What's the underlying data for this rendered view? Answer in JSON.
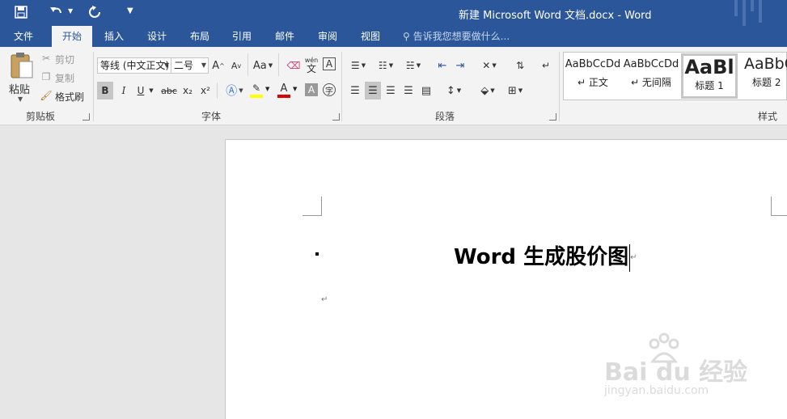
{
  "window": {
    "title": "新建 Microsoft Word 文档.docx - Word"
  },
  "qat": {
    "save_icon": "save-icon",
    "undo_icon": "undo-icon",
    "redo_icon": "redo-icon",
    "customize_icon": "customize-qat-icon"
  },
  "tabs": [
    {
      "label": "文件"
    },
    {
      "label": "开始"
    },
    {
      "label": "插入"
    },
    {
      "label": "设计"
    },
    {
      "label": "布局"
    },
    {
      "label": "引用"
    },
    {
      "label": "邮件"
    },
    {
      "label": "审阅"
    },
    {
      "label": "视图"
    }
  ],
  "tell_me": {
    "placeholder": "告诉我您想要做什么..."
  },
  "clipboard": {
    "paste": "粘贴",
    "cut": "剪切",
    "copy": "复制",
    "format_painter": "格式刷",
    "group_label": "剪贴板"
  },
  "font": {
    "family": "等线 (中文正文)",
    "size": "二号",
    "grow": "A",
    "shrink": "A",
    "change_case": "Aa",
    "bold": "B",
    "italic": "I",
    "underline": "U",
    "strike": "abc",
    "sub": "x₂",
    "sup": "x²",
    "wen": "wén",
    "wen_char": "文",
    "box_a": "A",
    "group_label": "字体"
  },
  "paragraph": {
    "group_label": "段落"
  },
  "styles": {
    "items": [
      {
        "preview": "AaBbCcDd",
        "name": "正文"
      },
      {
        "preview": "AaBbCcDd",
        "name": "无间隔"
      },
      {
        "preview": "AaBl",
        "name": "标题 1"
      },
      {
        "preview": "AaBbC",
        "name": "标题 2"
      }
    ],
    "group_label": "样式"
  },
  "document": {
    "heading": "Word 生成股价图",
    "para_mark": "↵"
  },
  "watermark": {
    "brand": "Bai  du 经验",
    "url": "jingyan.baidu.com"
  },
  "colors": {
    "brand": "#2b579a",
    "highlight": "#ffff00",
    "font_color": "#e00000"
  }
}
